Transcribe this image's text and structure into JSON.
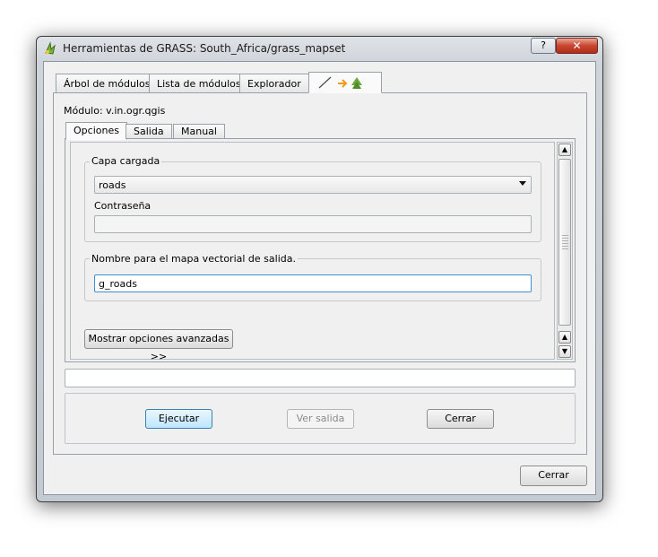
{
  "window": {
    "title": "Herramientas de GRASS: South_Africa/grass_mapset",
    "help_glyph": "?",
    "close_glyph": "✕"
  },
  "main_tabs": [
    "Árbol de módulos",
    "Lista de módulos",
    "Explorador"
  ],
  "module_label": "Módulo: v.in.ogr.qgis",
  "sub_tabs": [
    "Opciones",
    "Salida",
    "Manual"
  ],
  "group1": {
    "legend": "Capa cargada",
    "select_value": "roads",
    "password_label": "Contraseña",
    "password_value": ""
  },
  "group2": {
    "legend": "Nombre para el mapa vectorial de salida.",
    "output_value": "g_roads"
  },
  "advanced_button": "Mostrar opciones avanzadas >>",
  "progress_value": "",
  "buttons": {
    "run": "Ejecutar",
    "view_output": "Ver salida",
    "close_inner": "Cerrar",
    "close_dialog": "Cerrar"
  }
}
